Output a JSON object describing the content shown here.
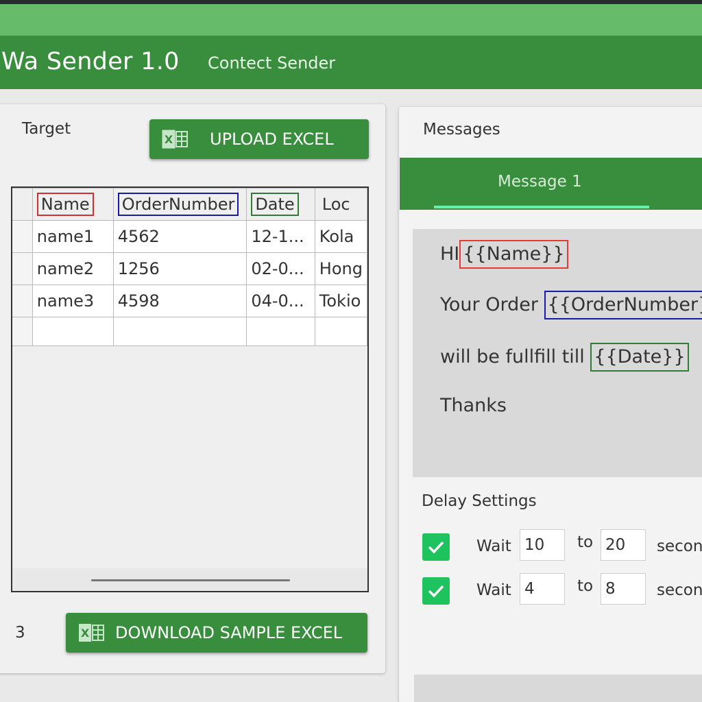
{
  "app": {
    "title": "Wa Sender 1.0",
    "subtitle": "Contect Sender"
  },
  "target": {
    "label": "Target",
    "upload_label": "UPLOAD EXCEL",
    "download_label": "DOWNLOAD SAMPLE EXCEL",
    "count": "3",
    "columns": [
      "Name",
      "OrderNumber",
      "Date",
      "Loc"
    ],
    "rows": [
      [
        "name1",
        "4562",
        "12-1...",
        "Kola"
      ],
      [
        "name2",
        "1256",
        "02-0...",
        "Hong"
      ],
      [
        "name3",
        "4598",
        "04-0...",
        "Tokio"
      ]
    ]
  },
  "messages": {
    "label": "Messages",
    "tab_label": "Message 1",
    "body": {
      "line1_text": "HI",
      "line1_ph": "{{Name}}",
      "line2_text": "Your Order ",
      "line2_ph": "{{OrderNumber}}",
      "line3_text": "will be fullfill till ",
      "line3_ph": "{{Date}}",
      "line4_text": "Thanks"
    }
  },
  "delay": {
    "title": "Delay Settings",
    "rows": [
      {
        "checked": true,
        "wait": "Wait",
        "from": "10",
        "to_label": "to",
        "to": "20",
        "unit": "seconds"
      },
      {
        "checked": true,
        "wait": "Wait",
        "from": "4",
        "to_label": "to",
        "to": "8",
        "unit": "seconds"
      }
    ]
  },
  "colors": {
    "header": "#388e3c",
    "band": "#66bb6a",
    "checkbox": "#1fc35d",
    "ph_name": "#e53935",
    "ph_order": "#1a1aa8",
    "ph_date": "#2e7d32"
  }
}
